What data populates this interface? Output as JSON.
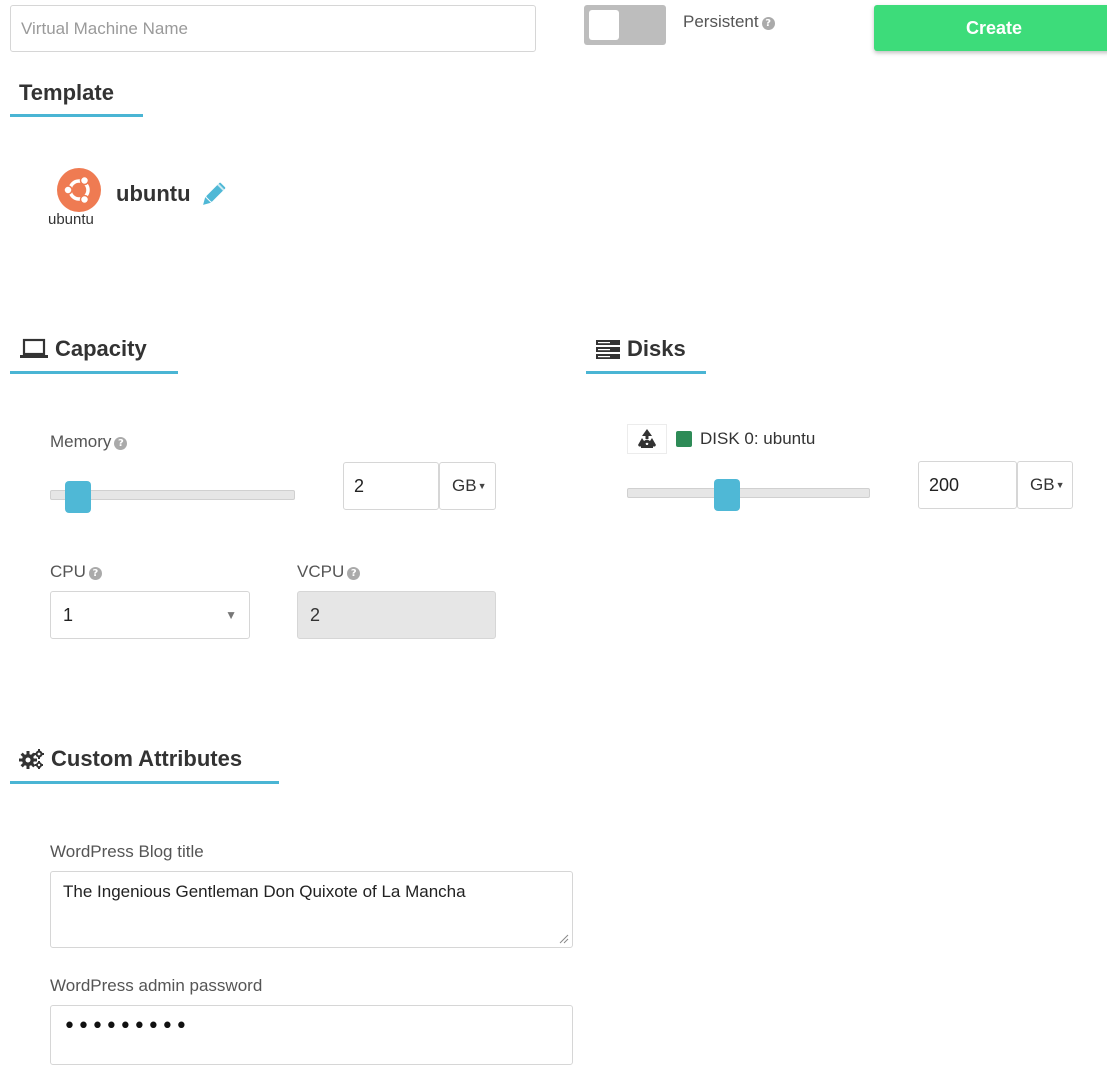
{
  "topbar": {
    "vm_name_placeholder": "Virtual Machine Name",
    "vm_name_value": "",
    "persistent_label": "Persistent",
    "persistent_on": false,
    "create_label": "Create",
    "create_color": "#3ddc7a"
  },
  "template": {
    "heading": "Template",
    "name": "ubuntu",
    "logo_caption": "ubuntu",
    "logo_color": "#ef7b52"
  },
  "capacity": {
    "heading": "Capacity",
    "memory_label": "Memory",
    "memory_value": "2",
    "memory_unit": "GB",
    "cpu_label": "CPU",
    "cpu_value": "1",
    "vcpu_label": "VCPU",
    "vcpu_value": "2"
  },
  "disks": {
    "heading": "Disks",
    "disk_label": "DISK 0: ubuntu",
    "disk_size_value": "200",
    "disk_size_unit": "GB",
    "disk_status_color": "#2e8b57"
  },
  "custom_attributes": {
    "heading": "Custom Attributes",
    "blog_title_label": "WordPress Blog title",
    "blog_title_value": "The Ingenious Gentleman Don Quixote of La Mancha",
    "admin_password_label": "WordPress admin password",
    "admin_password_masked": "•••••••••"
  },
  "icons": {
    "help": "?",
    "caret": "▼"
  },
  "accent_color": "#4ab5d4"
}
